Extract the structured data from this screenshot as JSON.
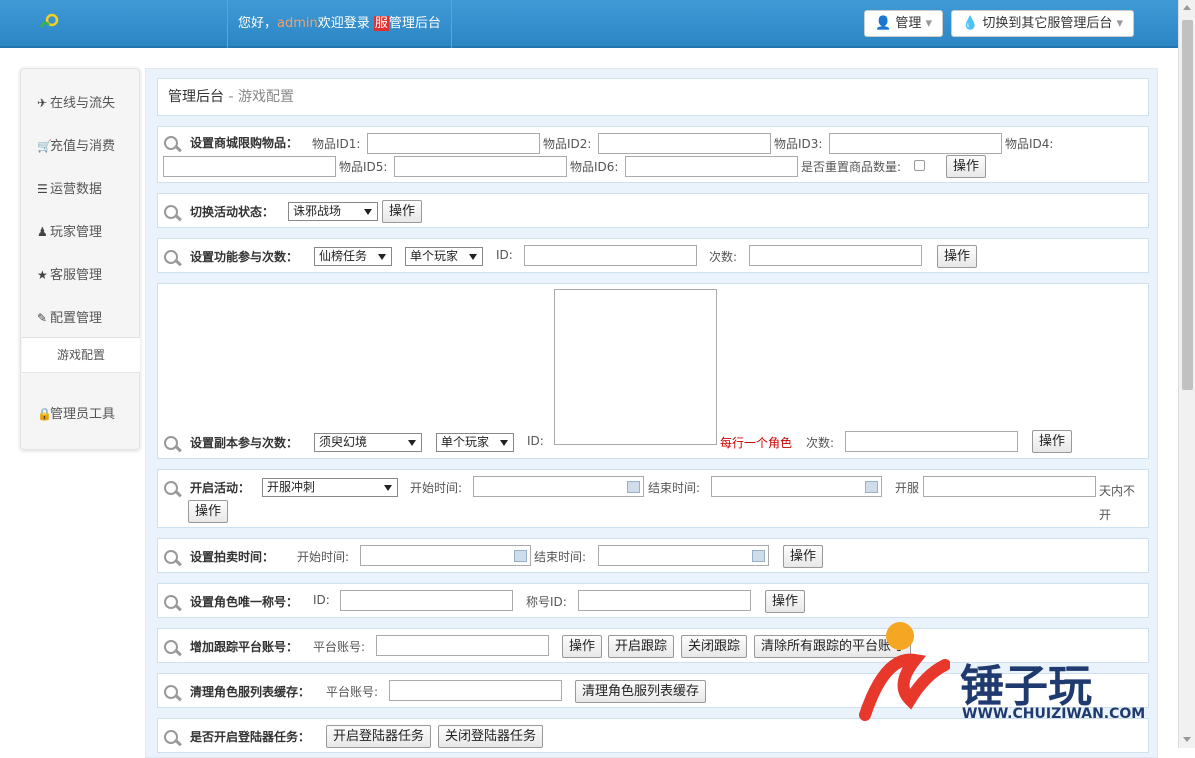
{
  "header": {
    "greeting": "您好，",
    "username": "admin",
    "welcome": "欢迎登录",
    "server_badge": "服",
    "backend": "管理后台",
    "manage_button": "管理",
    "switch_button": "切换到其它服管理后台"
  },
  "sidebar": {
    "items": [
      {
        "label": "在线与流失",
        "icon": "plane-icon"
      },
      {
        "label": "充值与消费",
        "icon": "cart-icon"
      },
      {
        "label": "运营数据",
        "icon": "list-icon"
      },
      {
        "label": "玩家管理",
        "icon": "user-icon"
      },
      {
        "label": "客服管理",
        "icon": "star-icon"
      },
      {
        "label": "配置管理",
        "icon": "edit-icon"
      },
      {
        "label": "管理员工具",
        "icon": "lock-icon"
      }
    ],
    "active_sub": "游戏配置"
  },
  "breadcrumb": {
    "title": "管理后台",
    "separator": " - ",
    "current": "游戏配置"
  },
  "sections": {
    "shop_limit": {
      "label": "设置商城限购物品：",
      "item1": "物品ID1:",
      "item2": "物品ID2:",
      "item3": "物品ID3:",
      "item4": "物品ID4:",
      "item5": "物品ID5:",
      "item6": "物品ID6:",
      "reset": "是否重置商品数量:",
      "button": "操作"
    },
    "activity_state": {
      "label": "切换活动状态：",
      "select": "诛邪战场",
      "button": "操作"
    },
    "func_count": {
      "label": "设置功能参与次数：",
      "select1": "仙榜任务",
      "select2": "单个玩家",
      "id": "ID:",
      "count": "次数:",
      "button": "操作"
    },
    "dungeon_count": {
      "label": "设置副本参与次数：",
      "select1": "须臾幻境",
      "select2": "单个玩家",
      "id": "ID:",
      "hint": "每行一个角色",
      "count": "次数:",
      "button": "操作"
    },
    "open_activity": {
      "label": "开启活动：",
      "select": "开服冲刺",
      "start": "开始时间:",
      "end": "结束时间:",
      "server": "开服",
      "days": "天内不开",
      "button": "操作"
    },
    "auction_time": {
      "label": "设置拍卖时间：",
      "start": "开始时间:",
      "end": "结束时间:",
      "button": "操作"
    },
    "role_title": {
      "label": "设置角色唯一称号：",
      "id": "ID:",
      "title_id": "称号ID:",
      "button": "操作"
    },
    "track_account": {
      "label": "增加跟踪平台账号：",
      "account": "平台账号:",
      "button": "操作",
      "start": "开启跟踪",
      "stop": "关闭跟踪",
      "clear": "清除所有跟踪的平台账号"
    },
    "clear_cache": {
      "label": "清理角色服列表缓存：",
      "account": "平台账号:",
      "button": "清理角色服列表缓存"
    },
    "login_task": {
      "label": "是否开启登陆器任务：",
      "open": "开启登陆器任务",
      "close": "关闭登陆器任务"
    }
  },
  "watermark": {
    "text": "锤子玩",
    "url": "WWW.CHUIZIWAN.COM"
  }
}
